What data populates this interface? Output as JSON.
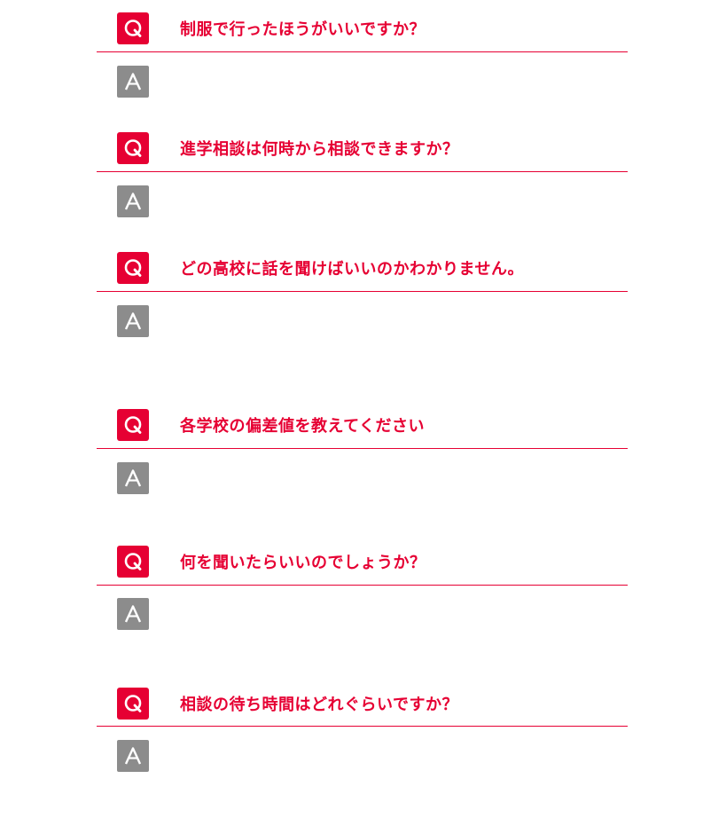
{
  "colors": {
    "accent": "#e60033",
    "answer_badge": "#8c8c8c"
  },
  "icons": {
    "question": "q-letter-icon",
    "answer": "a-letter-icon"
  },
  "faq": [
    {
      "question": "制服で行ったほうがいいですか？",
      "answer": ""
    },
    {
      "question": "進学相談は何時から相談できますか？",
      "answer": ""
    },
    {
      "question": "どの高校に話を聞けばいいのかわかりません。",
      "answer": ""
    },
    {
      "question": "各学校の偏差値を教えてください",
      "answer": ""
    },
    {
      "question": "何を聞いたらいいのでしょうか？",
      "answer": ""
    },
    {
      "question": "相談の待ち時間はどれぐらいですか？",
      "answer": ""
    }
  ]
}
